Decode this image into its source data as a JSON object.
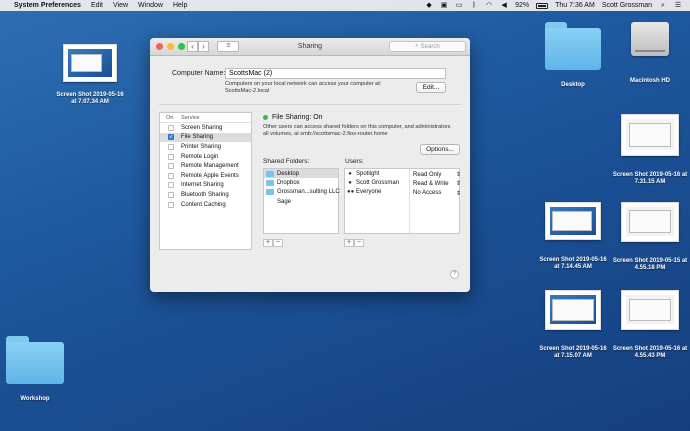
{
  "menubar": {
    "apple": "",
    "app_name": "System Preferences",
    "menus": [
      "Edit",
      "View",
      "Window",
      "Help"
    ],
    "battery_percent": "92%",
    "clock": "Thu 7:36 AM",
    "user": "Scott Grossman"
  },
  "desktop": {
    "items": [
      {
        "label": "Screen Shot 2019-05-16 at 7.07.34 AM"
      },
      {
        "label": "Desktop"
      },
      {
        "label": "Macintosh HD"
      },
      {
        "label": "Screen Shot 2019-05-16 at 7.31.15 AM"
      },
      {
        "label": "Screen Shot 2019-05-16 at 7.14.45 AM"
      },
      {
        "label": "Screen Shot 2019-05-15 at 4.55.18 PM"
      },
      {
        "label": "Screen Shot 2019-05-16 at 7.15.07 AM"
      },
      {
        "label": "Screen Shot 2019-05-16 at 4.55.43 PM"
      },
      {
        "label": "Workshop"
      }
    ]
  },
  "window": {
    "title": "Sharing",
    "search_placeholder": "Search",
    "computer_name_label": "Computer Name:",
    "computer_name_value": "ScottsMac (2)",
    "local_note_line1": "Computers on your local network can access your computer at:",
    "local_note_line2": "ScottsMac-2.local",
    "edit_button": "Edit...",
    "service_headers": {
      "on": "On",
      "service": "Service"
    },
    "services": [
      {
        "label": "Screen Sharing",
        "checked": false
      },
      {
        "label": "File Sharing",
        "checked": true
      },
      {
        "label": "Printer Sharing",
        "checked": false
      },
      {
        "label": "Remote Login",
        "checked": false
      },
      {
        "label": "Remote Management",
        "checked": false
      },
      {
        "label": "Remote Apple Events",
        "checked": false
      },
      {
        "label": "Internet Sharing",
        "checked": false
      },
      {
        "label": "Bluetooth Sharing",
        "checked": false
      },
      {
        "label": "Content Caching",
        "checked": false
      }
    ],
    "status_title": "File Sharing: On",
    "status_desc_line1": "Other users can access shared folders on this computer, and administrators",
    "status_desc_line2": "all volumes, at smb://scottsmac-2.fios-router.home",
    "options_button": "Options...",
    "shared_folders_label": "Shared Folders:",
    "shared_folders": [
      "Desktop",
      "Dropbox",
      "Grossman...sulting LLC",
      "Sage"
    ],
    "users_label": "Users:",
    "users": [
      {
        "name": "Spotlight",
        "perm": "Read Only"
      },
      {
        "name": "Scott Grossman",
        "perm": "Read & Write"
      },
      {
        "name": "Everyone",
        "perm": "No Access"
      }
    ],
    "plus": "+",
    "minus": "−",
    "help": "?",
    "accent_color": "#3a86f4",
    "status_color": "#2ec23e"
  }
}
